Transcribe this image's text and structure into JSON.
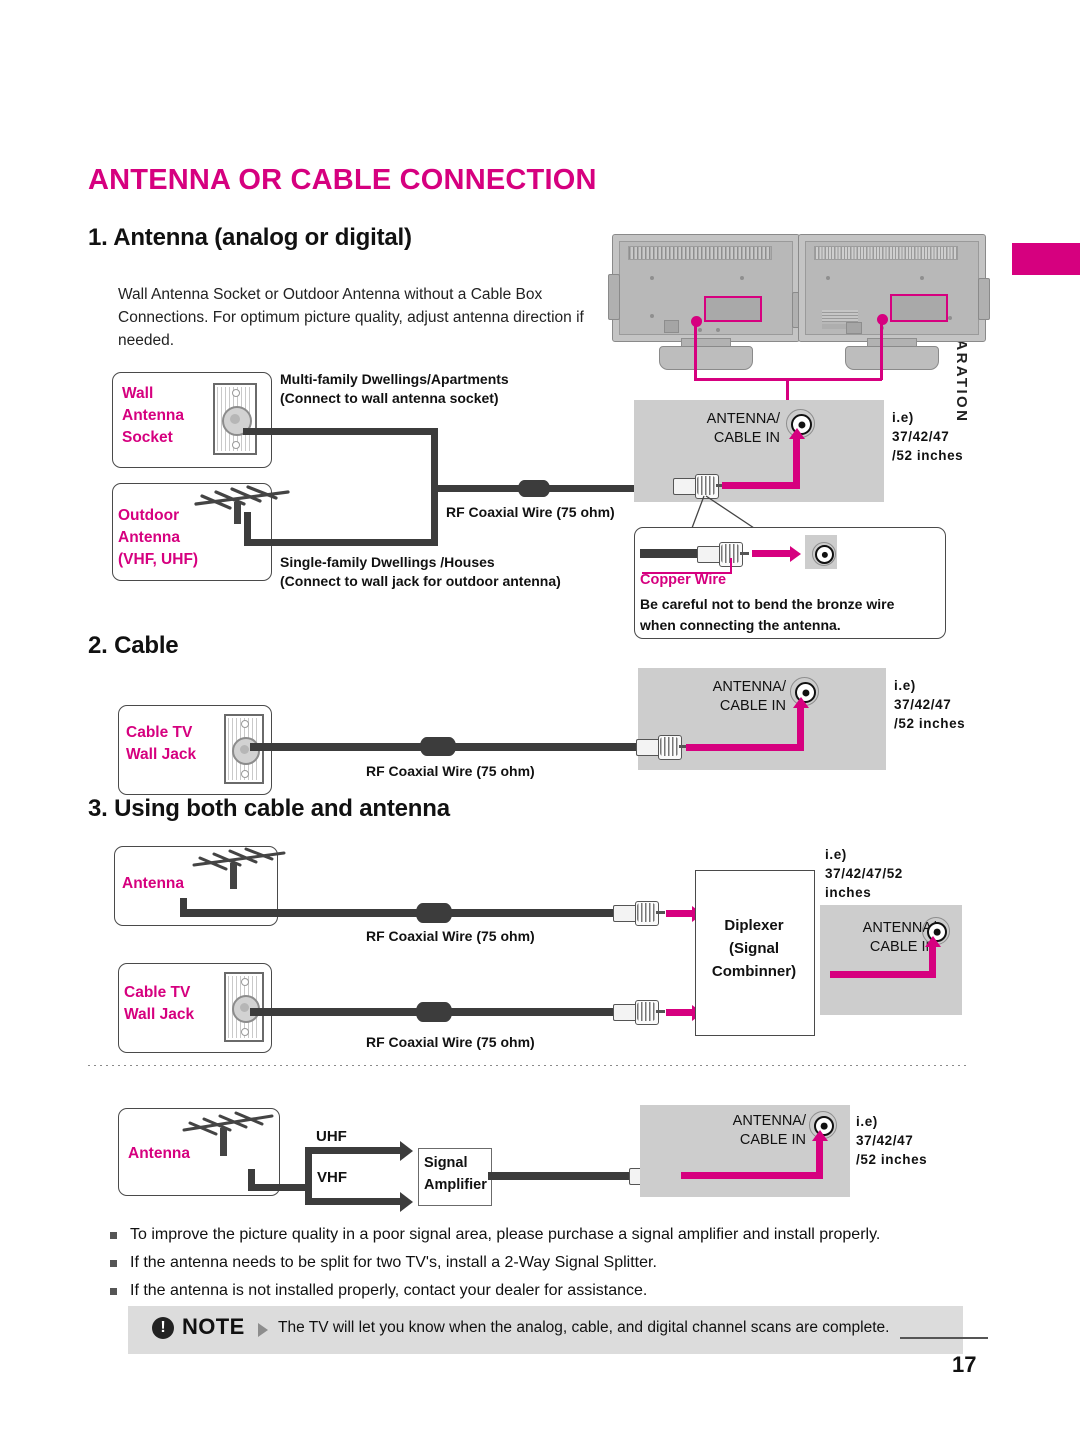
{
  "page": {
    "title": "ANTENNA OR CABLE CONNECTION",
    "number": "17",
    "sidebar_label": "PREPARATION"
  },
  "sections": {
    "s1": {
      "heading": "1. Antenna (analog or digital)",
      "intro": "Wall Antenna Socket or Outdoor Antenna without a Cable Box Connections. For optimum picture quality, adjust antenna direction if needed.",
      "wall_socket_label": "Wall\nAntenna\nSocket",
      "wall_socket_label_l1": "Wall",
      "wall_socket_label_l2": "Antenna",
      "wall_socket_label_l3": "Socket",
      "outdoor_label_l1": "Outdoor",
      "outdoor_label_l2": "Antenna",
      "outdoor_label_l3": "(VHF, UHF)",
      "multi_family_l1": "Multi-family Dwellings/Apartments",
      "multi_family_l2": "(Connect to wall antenna socket)",
      "single_family_l1": "Single-family Dwellings /Houses",
      "single_family_l2": "(Connect to wall jack for outdoor antenna)",
      "coax_label": "RF Coaxial Wire (75 ohm)",
      "port_l1": "ANTENNA/",
      "port_l2": "CABLE IN",
      "ie_l1": "i.e)",
      "ie_l2": "37/42/47",
      "ie_l3": "/52 inches",
      "copper_wire_label": "Copper Wire",
      "warning_l1": "Be careful not to bend the bronze wire",
      "warning_l2": "when connecting the antenna."
    },
    "s2": {
      "heading": "2. Cable",
      "cable_tv_l1": "Cable TV",
      "cable_tv_l2": "Wall Jack",
      "coax_label": "RF Coaxial Wire (75 ohm)",
      "port_l1": "ANTENNA/",
      "port_l2": "CABLE IN",
      "ie_l1": "i.e)",
      "ie_l2": "37/42/47",
      "ie_l3": "/52 inches"
    },
    "s3": {
      "heading": "3. Using both cable and antenna",
      "antenna_label": "Antenna",
      "cable_tv_l1": "Cable TV",
      "cable_tv_l2": "Wall Jack",
      "coax_label_top": "RF Coaxial Wire (75 ohm)",
      "coax_label_bottom": "RF Coaxial Wire (75 ohm)",
      "diplexer_l1": "Diplexer",
      "diplexer_l2": "(Signal",
      "diplexer_l3": "Combinner)",
      "port_l1": "ANTENNA/",
      "port_l2": "CABLE IN",
      "ie_l1": "i.e)",
      "ie_l2": "37/42/47/52",
      "ie_l3": "inches"
    },
    "s4": {
      "antenna_label": "Antenna",
      "uhf_label": "UHF",
      "vhf_label": "VHF",
      "amp_l1": "Signal",
      "amp_l2": "Amplifier",
      "port_l1": "ANTENNA/",
      "port_l2": "CABLE IN",
      "ie_l1": "i.e)",
      "ie_l2": "37/42/47",
      "ie_l3": "/52 inches"
    }
  },
  "bullets": [
    "To improve the picture quality in a poor signal area, please purchase a signal amplifier and install properly.",
    "If the antenna needs to be split for two TV's, install a 2-Way Signal Splitter.",
    "If the antenna is not installed properly, contact your dealer for assistance."
  ],
  "note": {
    "icon_glyph": "!",
    "word": "NOTE",
    "text": "The TV will let you know when the analog, cable, and digital channel scans are complete."
  },
  "colors": {
    "accent": "#D6007F",
    "wire": "#3C3C3C",
    "panel": "#CDCDCD",
    "note_bg": "#DCDCDC"
  }
}
